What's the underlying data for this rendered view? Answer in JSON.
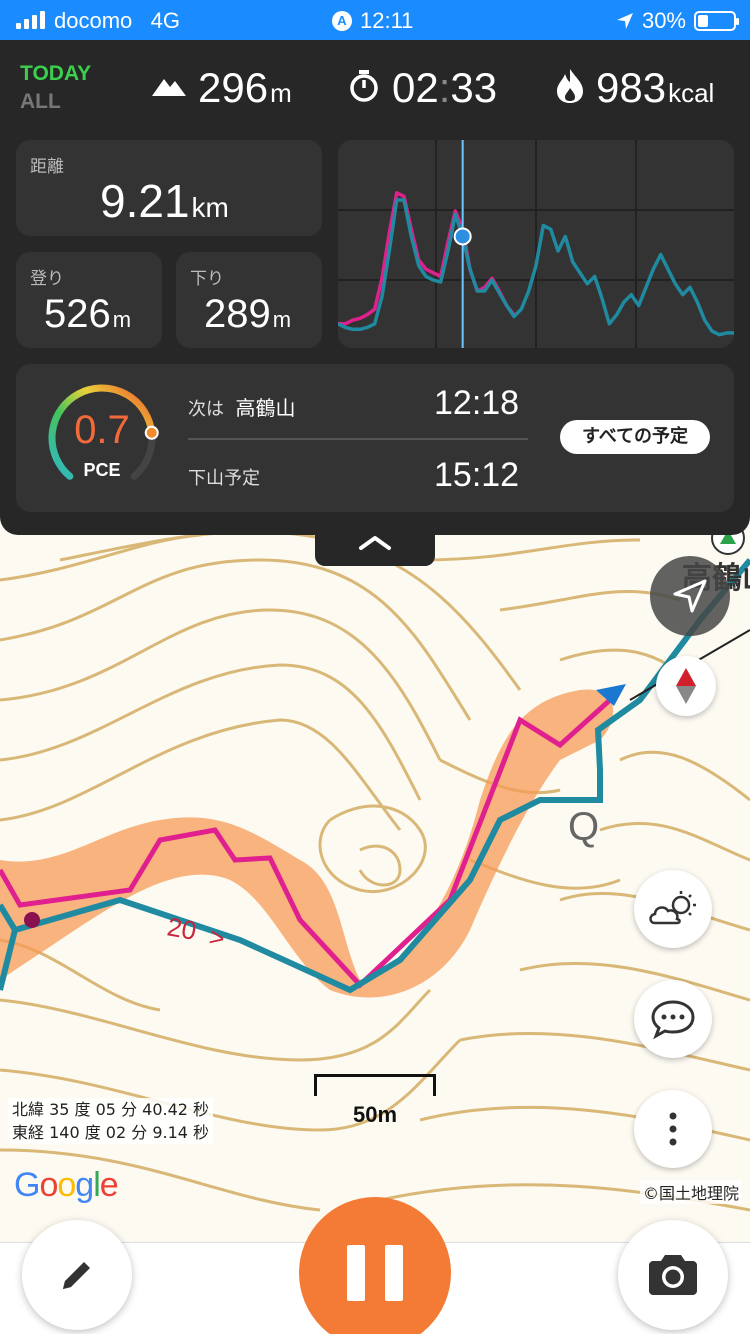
{
  "status_bar": {
    "carrier": "docomo",
    "network": "4G",
    "time": "12:11",
    "battery": "30%",
    "battery_level": 0.3
  },
  "summary": {
    "period_today": "TODAY",
    "period_all": "ALL",
    "elevation_value": "296",
    "elevation_unit": "m",
    "time_hours": "02",
    "time_sep": ":",
    "time_minutes": "33",
    "calories_value": "983",
    "calories_unit": "kcal"
  },
  "stats": {
    "distance_label": "距離",
    "distance_value": "9.21",
    "distance_unit": "km",
    "ascent_label": "登り",
    "ascent_value": "526",
    "ascent_unit": "m",
    "descent_label": "下り",
    "descent_value": "289",
    "descent_unit": "m"
  },
  "plan": {
    "pce_value": "0.7",
    "pce_label": "PCE",
    "pce_level": 0.8,
    "next_label": "次は",
    "next_place": "高鶴山",
    "next_time": "12:18",
    "descent_plan_label": "下山予定",
    "descent_plan_time": "15:12",
    "all_plans_button": "すべての予定"
  },
  "map": {
    "place_label": "高鶴山",
    "route_marker": "20",
    "coords_lat": "北緯 35 度 05 分 40.42 秒",
    "coords_lon": "東経 140 度 02 分 9.14 秒",
    "scale_label": "50m",
    "google_logo": "Google",
    "attribution": "©国土地理院"
  },
  "colors": {
    "accent": "#f47b35",
    "actual_track": "#1f8aa0",
    "planned_track": "#e0208f",
    "panel_bg": "#272727",
    "today_green": "#3ccf4e"
  },
  "chart_data": {
    "type": "line",
    "series": [
      {
        "values": [
          0.1,
          0.1,
          0.12,
          0.13,
          0.15,
          0.18,
          0.35,
          0.6,
          0.82,
          0.8,
          0.62,
          0.45,
          0.4,
          0.38,
          0.36,
          0.55,
          0.72,
          0.62,
          0.4,
          0.28,
          0.3,
          0.35,
          0.28,
          0.2,
          0.15
        ]
      },
      {
        "values": [
          0.1,
          0.08,
          0.07,
          0.07,
          0.08,
          0.1,
          0.25,
          0.5,
          0.78,
          0.78,
          0.58,
          0.42,
          0.36,
          0.34,
          0.33,
          0.5,
          0.7,
          0.58,
          0.4,
          0.28,
          0.28,
          0.34,
          0.27,
          0.2,
          0.14,
          0.18,
          0.28,
          0.42,
          0.64,
          0.62,
          0.5,
          0.58,
          0.44,
          0.38,
          0.32,
          0.36,
          0.24,
          0.1,
          0.15,
          0.22,
          0.26,
          0.2,
          0.3,
          0.4,
          0.48,
          0.4,
          0.32,
          0.26,
          0.3,
          0.22,
          0.12,
          0.06,
          0.04,
          0.05,
          0.05
        ]
      }
    ],
    "current_index": 17,
    "grid": true
  }
}
